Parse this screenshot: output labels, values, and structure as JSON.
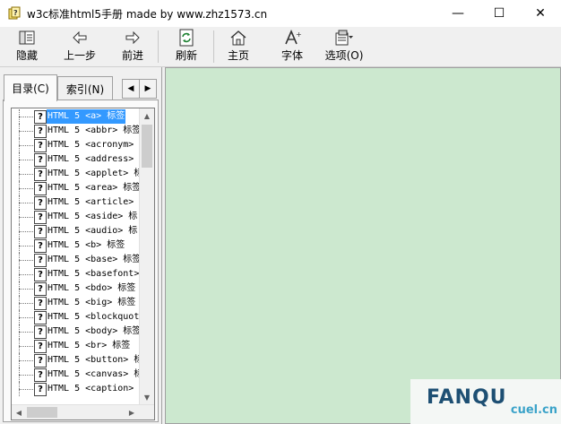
{
  "window": {
    "title": "w3c标准html5手册 made by www.zhz1573.cn",
    "min_glyph": "—",
    "max_glyph": "☐",
    "close_glyph": "✕"
  },
  "toolbar": {
    "hide": "隐藏",
    "back": "上一步",
    "forward": "前进",
    "refresh": "刷新",
    "home": "主页",
    "font": "字体",
    "options": "选项(O)"
  },
  "tabs": {
    "contents": "目录(C)",
    "index": "索引(N)",
    "prev": "◀",
    "next": "▶"
  },
  "tree": {
    "items": [
      "HTML 5 <a> 标签",
      "HTML 5 <abbr> 标签",
      "HTML 5 <acronym>",
      "HTML 5 <address>",
      "HTML 5 <applet> 标",
      "HTML 5 <area> 标签",
      "HTML 5 <article>",
      "HTML 5 <aside> 标",
      "HTML 5 <audio> 标",
      "HTML 5 <b> 标签",
      "HTML 5 <base> 标签",
      "HTML 5 <basefont>",
      "HTML 5 <bdo> 标签",
      "HTML 5 <big> 标签",
      "HTML 5 <blockquot",
      "HTML 5 <body> 标签",
      "HTML 5 <br> 标签",
      "HTML 5 <button> 标",
      "HTML 5 <canvas> 标",
      "HTML 5 <caption>"
    ],
    "selected_index": 0,
    "page_icon_glyph": "?"
  },
  "watermark": {
    "text": "FANQU",
    "sub": "cuel.cn"
  },
  "colors": {
    "content_bg": "#cce8cf",
    "selection": "#3399ff"
  }
}
